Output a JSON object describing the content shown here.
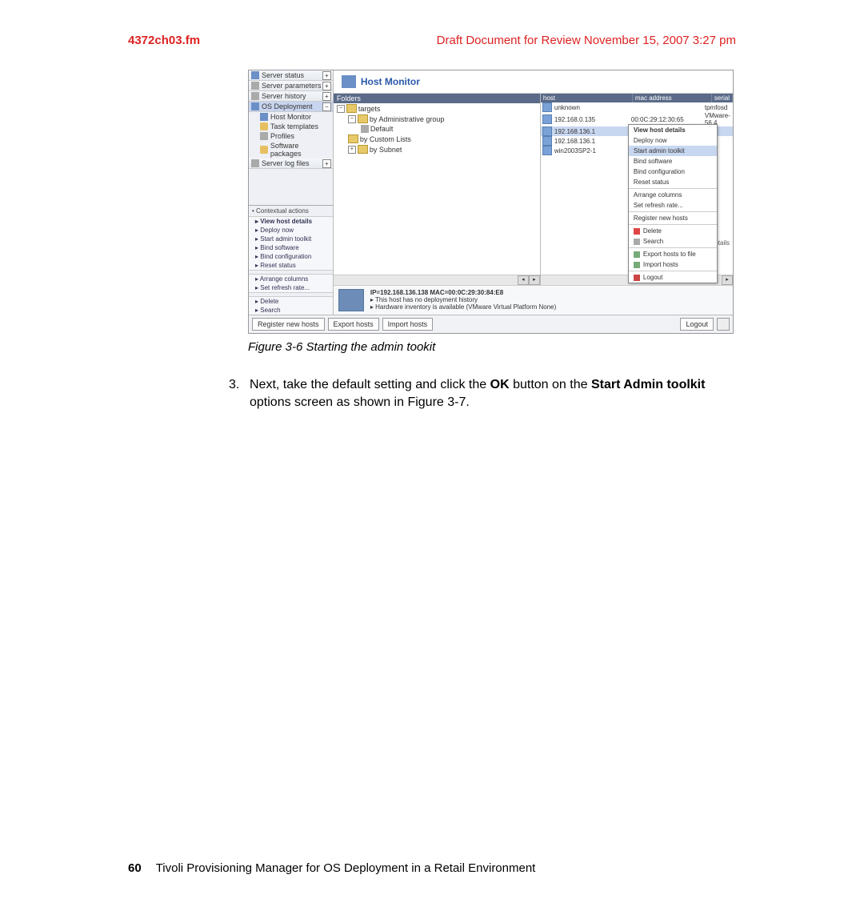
{
  "header": {
    "left": "4372ch03.fm",
    "right": "Draft Document for Review November 15, 2007 3:27 pm"
  },
  "screenshot": {
    "nav": {
      "items": [
        {
          "label": "Server status",
          "exp": "+"
        },
        {
          "label": "Server parameters",
          "exp": "+"
        },
        {
          "label": "Server history",
          "exp": "+"
        },
        {
          "label": "OS Deployment",
          "exp": "−",
          "selected": true
        },
        {
          "label": "Server log files",
          "exp": "+"
        }
      ],
      "subs": [
        "Host Monitor",
        "Task templates",
        "Profiles",
        "Software packages"
      ]
    },
    "ctx_left": {
      "head": "• Contextual actions",
      "items1": [
        "View host details",
        "Deploy now",
        "Start admin toolkit",
        "Bind software",
        "Bind configuration",
        "Reset status"
      ],
      "items2": [
        "Arrange columns",
        "Set refresh rate..."
      ],
      "items3": [
        "Delete",
        "Search"
      ]
    },
    "title": "Host Monitor",
    "folders": {
      "head": "Folders",
      "tree": {
        "targets": "targets",
        "byAdmin": "by Administrative group",
        "default": "Default",
        "byCustom": "by Custom Lists",
        "bySubnet": "by Subnet"
      }
    },
    "hosts": {
      "head": {
        "c1": "host",
        "c2": "mac address",
        "c3": "serial"
      },
      "rows": [
        {
          "c1": "unknown",
          "c2": "",
          "c3": "tpmfosd"
        },
        {
          "c1": "192.168.0.135",
          "c2": "00:0C:29:12:30:65",
          "c3": "VMware-56 4"
        },
        {
          "c1": "192.168.136.1",
          "c2": "",
          "c3": "",
          "sel": true
        },
        {
          "c1": "192.168.136.1",
          "c2": "",
          "c3": ""
        },
        {
          "c1": "win2003SP2-1",
          "c2": "",
          "c3": ""
        }
      ],
      "ctx": {
        "items": [
          "View host details",
          "Deploy now",
          "Start admin toolkit",
          "Bind software",
          "Bind configuration",
          "Reset status",
          "-",
          "Arrange columns",
          "Set refresh rate...",
          "-",
          "Register new hosts",
          "-",
          "Delete",
          "Search",
          "-",
          "Export hosts to file",
          "Import hosts",
          "-",
          "Logout"
        ],
        "bottom_line": "▸ View host details"
      }
    },
    "info": {
      "line1": "IP=192.168.136.138   MAC=00:0C:29:30:84:E8",
      "line2": "▸ This host has no deployment history",
      "line3": "▸ Hardware inventory is available (VMware Virtual Platform None)"
    },
    "buttons": {
      "register": "Register new hosts",
      "export": "Export hosts",
      "import": "Import hosts",
      "logout": "Logout"
    }
  },
  "caption": "Figure 3-6   Starting the admin tookit",
  "body": {
    "num": "3.",
    "text_pre": "Next, take the default setting and click the ",
    "ok": "OK",
    "mid": " button on the ",
    "start": "Start Admin toolkit",
    "post": " options screen as shown in Figure 3-7."
  },
  "footer": {
    "page": "60",
    "title": "Tivoli Provisioning Manager for OS Deployment in a Retail Environment"
  }
}
